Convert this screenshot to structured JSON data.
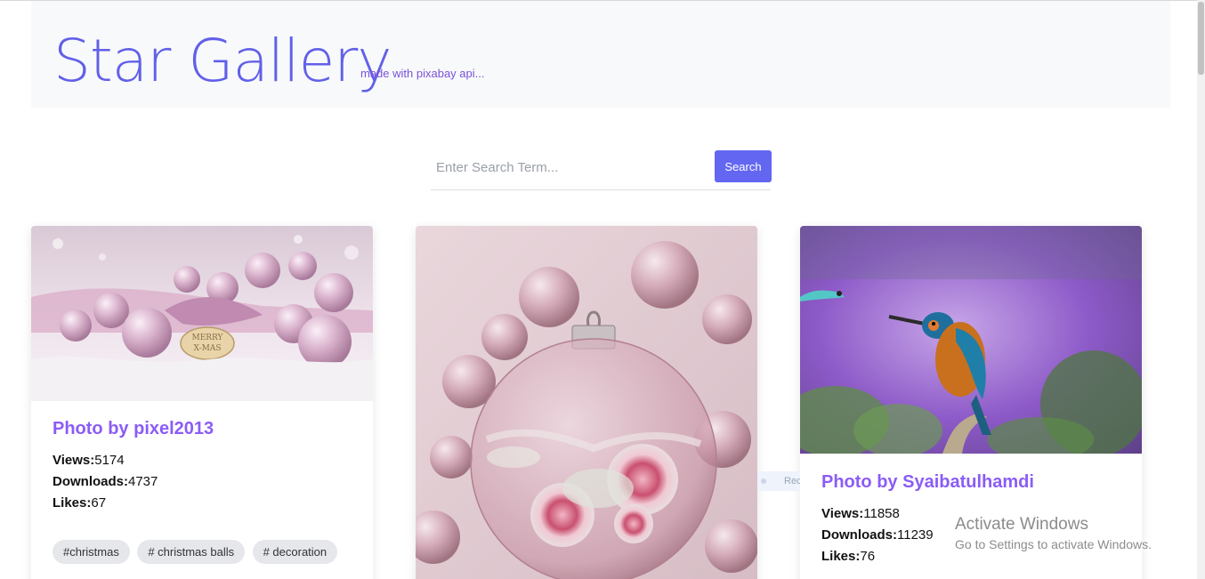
{
  "header": {
    "brand": "Star Gallery",
    "tagline": "made with pixabay api..."
  },
  "search": {
    "placeholder": "Enter Search Term...",
    "value": "",
    "button_label": "Search"
  },
  "cards": [
    {
      "title": "Photo by pixel2013",
      "views_label": "Views:",
      "views": "5174",
      "downloads_label": "Downloads:",
      "downloads": "4737",
      "likes_label": "Likes:",
      "likes": "67",
      "tags": [
        "#christmas",
        "# christmas balls",
        "# decoration"
      ]
    },
    {
      "title": "",
      "tags": []
    },
    {
      "title": "Photo by Syaibatulhamdi",
      "views_label": "Views:",
      "views": "11858",
      "downloads_label": "Downloads:",
      "downloads": "11239",
      "likes_label": "Likes:",
      "likes": "76",
      "tags": []
    }
  ],
  "overlay": {
    "tooltip_text": "Rectangle",
    "activate_title": "Activate Windows",
    "activate_sub": "Go to Settings to activate Windows."
  },
  "colors": {
    "brand": "#6160e8",
    "accent": "#6366f1",
    "title": "#8b5cf6"
  }
}
